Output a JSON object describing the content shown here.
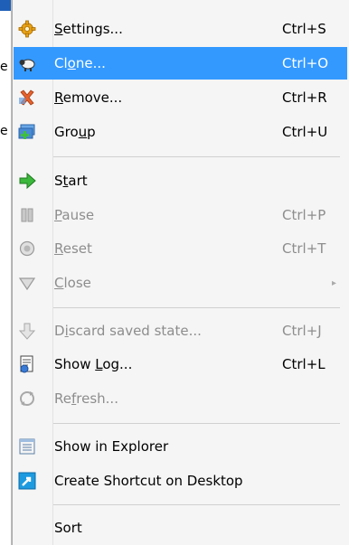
{
  "background": {
    "fragments": [
      "e",
      "e"
    ]
  },
  "menu": {
    "items": [
      {
        "id": "settings",
        "label": "Settings...",
        "mnemonic": "S",
        "shortcut": "Ctrl+S",
        "icon": "gear-icon",
        "enabled": true
      },
      {
        "id": "clone",
        "label": "Clone...",
        "mnemonic": "o",
        "shortcut": "Ctrl+O",
        "icon": "sheep-icon",
        "enabled": true,
        "highlighted": true
      },
      {
        "id": "remove",
        "label": "Remove...",
        "mnemonic": "R",
        "shortcut": "Ctrl+R",
        "icon": "remove-x-icon",
        "enabled": true
      },
      {
        "id": "group",
        "label": "Group",
        "mnemonic": "u",
        "shortcut": "Ctrl+U",
        "icon": "group-add-icon",
        "enabled": true
      },
      {
        "id": "start",
        "label": "Start",
        "mnemonic": "t",
        "shortcut": "",
        "icon": "start-arrow-icon",
        "enabled": true
      },
      {
        "id": "pause",
        "label": "Pause",
        "mnemonic": "P",
        "shortcut": "Ctrl+P",
        "icon": "pause-icon",
        "enabled": false
      },
      {
        "id": "reset",
        "label": "Reset",
        "mnemonic": "R",
        "shortcut": "Ctrl+T",
        "icon": "reset-icon",
        "enabled": false
      },
      {
        "id": "close",
        "label": "Close",
        "mnemonic": "C",
        "shortcut": "",
        "icon": "close-triangle-icon",
        "enabled": false,
        "submenu": true
      },
      {
        "id": "discard",
        "label": "Discard saved state...",
        "mnemonic": "i",
        "shortcut": "Ctrl+J",
        "icon": "discard-arrow-icon",
        "enabled": false
      },
      {
        "id": "showlog",
        "label": "Show Log...",
        "mnemonic": "L",
        "shortcut": "Ctrl+L",
        "icon": "log-icon",
        "enabled": true
      },
      {
        "id": "refresh",
        "label": "Refresh...",
        "mnemonic": "f",
        "shortcut": "",
        "icon": "refresh-icon",
        "enabled": false
      },
      {
        "id": "explorer",
        "label": "Show in Explorer",
        "mnemonic": "",
        "shortcut": "",
        "icon": "explorer-icon",
        "enabled": true
      },
      {
        "id": "shortcut",
        "label": "Create Shortcut on Desktop",
        "mnemonic": "",
        "shortcut": "",
        "icon": "shortcut-icon",
        "enabled": true
      },
      {
        "id": "sort",
        "label": "Sort",
        "mnemonic": "",
        "shortcut": "",
        "icon": "",
        "enabled": true
      }
    ],
    "submenu_arrow": "▸",
    "colors": {
      "highlight": "#3399ff",
      "disabled_text": "#8d8d8d"
    }
  }
}
